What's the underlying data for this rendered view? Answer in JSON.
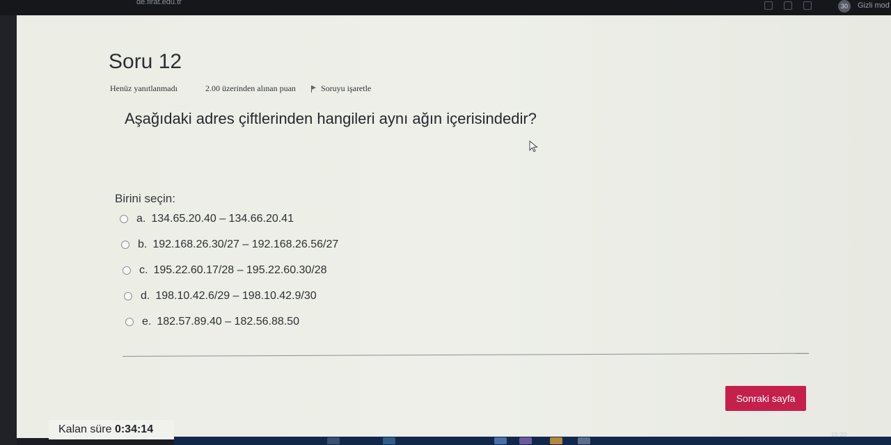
{
  "browser": {
    "url": "de.firat.edu.tr",
    "profile_badge": "30",
    "mode_label": "Gizli mod"
  },
  "question": {
    "title": "Soru 12",
    "status": "Henüz yanıtlanmadı",
    "points": "2.00 üzerinden alınan puan",
    "flag_label": "Soruyu işaretle",
    "text": "Aşağıdaki adres çiftlerinden hangileri aynı ağın içerisindedir?",
    "prompt": "Birini seçin:",
    "answers": [
      {
        "letter": "a.",
        "text": "134.65.20.40 – 134.66.20.41"
      },
      {
        "letter": "b.",
        "text": "192.168.26.30/27 – 192.168.26.56/27"
      },
      {
        "letter": "c.",
        "text": "195.22.60.17/28 – 195.22.60.30/28"
      },
      {
        "letter": "d.",
        "text": "198.10.42.6/29 – 198.10.42.9/30"
      },
      {
        "letter": "e.",
        "text": "182.57.89.40 – 182.56.88.50"
      }
    ]
  },
  "navigation": {
    "next_label": "Sonraki sayfa",
    "accent": "#c51f4c"
  },
  "timer": {
    "label": "Kalan süre",
    "value": "0:34:14"
  },
  "taskbar": {
    "clock": "15:20"
  }
}
